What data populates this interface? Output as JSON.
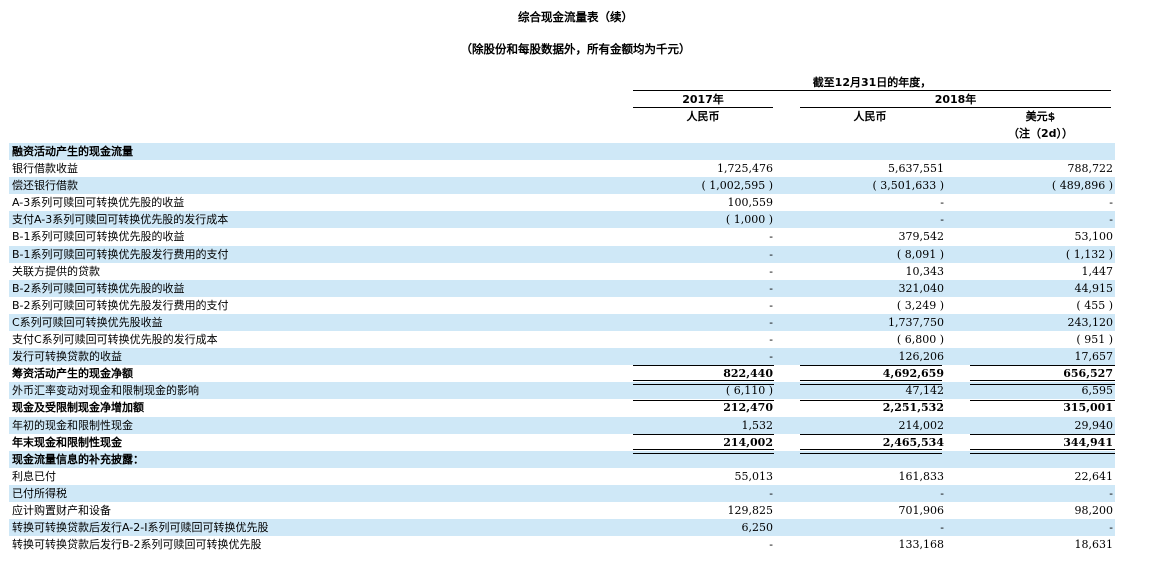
{
  "title": "综合现金流量表（续）",
  "subtitle": "（除股份和每股数据外，所有金额均为千元）",
  "header": {
    "period": "截至12月31日的年度，",
    "year_2017": "2017年",
    "year_2018": "2018年",
    "col1": "人民币",
    "col2": "人民币",
    "col3": "美元$",
    "col3_note": "（注（2d））"
  },
  "rows": [
    {
      "label": "融资活动产生的现金流量",
      "v": [
        "",
        "",
        ""
      ],
      "bold": true,
      "shade": true
    },
    {
      "label": "银行借款收益",
      "v": [
        "1,725,476",
        "5,637,551",
        "788,722"
      ]
    },
    {
      "label": "偿还银行借款",
      "v": [
        "( 1,002,595 )",
        "( 3,501,633 )",
        "( 489,896 )"
      ],
      "shade": true
    },
    {
      "label": "A-3系列可赎回可转换优先股的收益",
      "v": [
        "100,559",
        "-",
        "-"
      ]
    },
    {
      "label": "支付A-3系列可赎回可转换优先股的发行成本",
      "v": [
        "( 1,000 )",
        "-",
        "-"
      ],
      "shade": true
    },
    {
      "label": "B-1系列可赎回可转换优先股的收益",
      "v": [
        "-",
        "379,542",
        "53,100"
      ]
    },
    {
      "label": "B-1系列可赎回可转换优先股发行费用的支付",
      "v": [
        "-",
        "( 8,091 )",
        "( 1,132 )"
      ],
      "shade": true
    },
    {
      "label": "关联方提供的贷款",
      "v": [
        "-",
        "10,343",
        "1,447"
      ]
    },
    {
      "label": "B-2系列可赎回可转换优先股的收益",
      "v": [
        "-",
        "321,040",
        "44,915"
      ],
      "shade": true
    },
    {
      "label": "B-2系列可赎回可转换优先股发行费用的支付",
      "v": [
        "-",
        "( 3,249 )",
        "( 455 )"
      ]
    },
    {
      "label": "C系列可赎回可转换优先股收益",
      "v": [
        "-",
        "1,737,750",
        "243,120"
      ],
      "shade": true
    },
    {
      "label": "支付C系列可赎回可转换优先股的发行成本",
      "v": [
        "-",
        "( 6,800 )",
        "( 951 )"
      ]
    },
    {
      "label": "发行可转换贷款的收益",
      "v": [
        "-",
        "126,206",
        "17,657"
      ],
      "shade": true
    },
    {
      "label": "筹资活动产生的现金净额",
      "v": [
        "822,440",
        "4,692,659",
        "656,527"
      ],
      "bold": true
    },
    {
      "label": "外币汇率变动对现金和限制现金的影响",
      "v": [
        "( 6,110 )",
        "47,142",
        "6,595"
      ],
      "shade": true
    },
    {
      "label": "现金及受限制现金净增加额",
      "v": [
        "212,470",
        "2,251,532",
        "315,001"
      ],
      "bold": true
    },
    {
      "label": "年初的现金和限制性现金",
      "v": [
        "1,532",
        "214,002",
        "29,940"
      ],
      "shade": true
    },
    {
      "label": "年末现金和限制性现金",
      "v": [
        "214,002",
        "2,465,534",
        "344,941"
      ],
      "bold": true
    },
    {
      "label": "现金流量信息的补充披露：",
      "v": [
        "",
        "",
        ""
      ],
      "bold": true,
      "shade": true
    },
    {
      "label": "利息已付",
      "v": [
        "55,013",
        "161,833",
        "22,641"
      ]
    },
    {
      "label": "已付所得税",
      "v": [
        "-",
        "-",
        "-"
      ],
      "shade": true
    },
    {
      "label": "应计购置财产和设备",
      "v": [
        "129,825",
        "701,906",
        "98,200"
      ]
    },
    {
      "label": "转换可转换贷款后发行A-2-I系列可赎回可转换优先股",
      "v": [
        "6,250",
        "-",
        "-"
      ],
      "shade": true
    },
    {
      "label": "转换可转换贷款后发行B-2系列可赎回可转换优先股",
      "v": [
        "-",
        "133,168",
        "18,631"
      ]
    }
  ]
}
